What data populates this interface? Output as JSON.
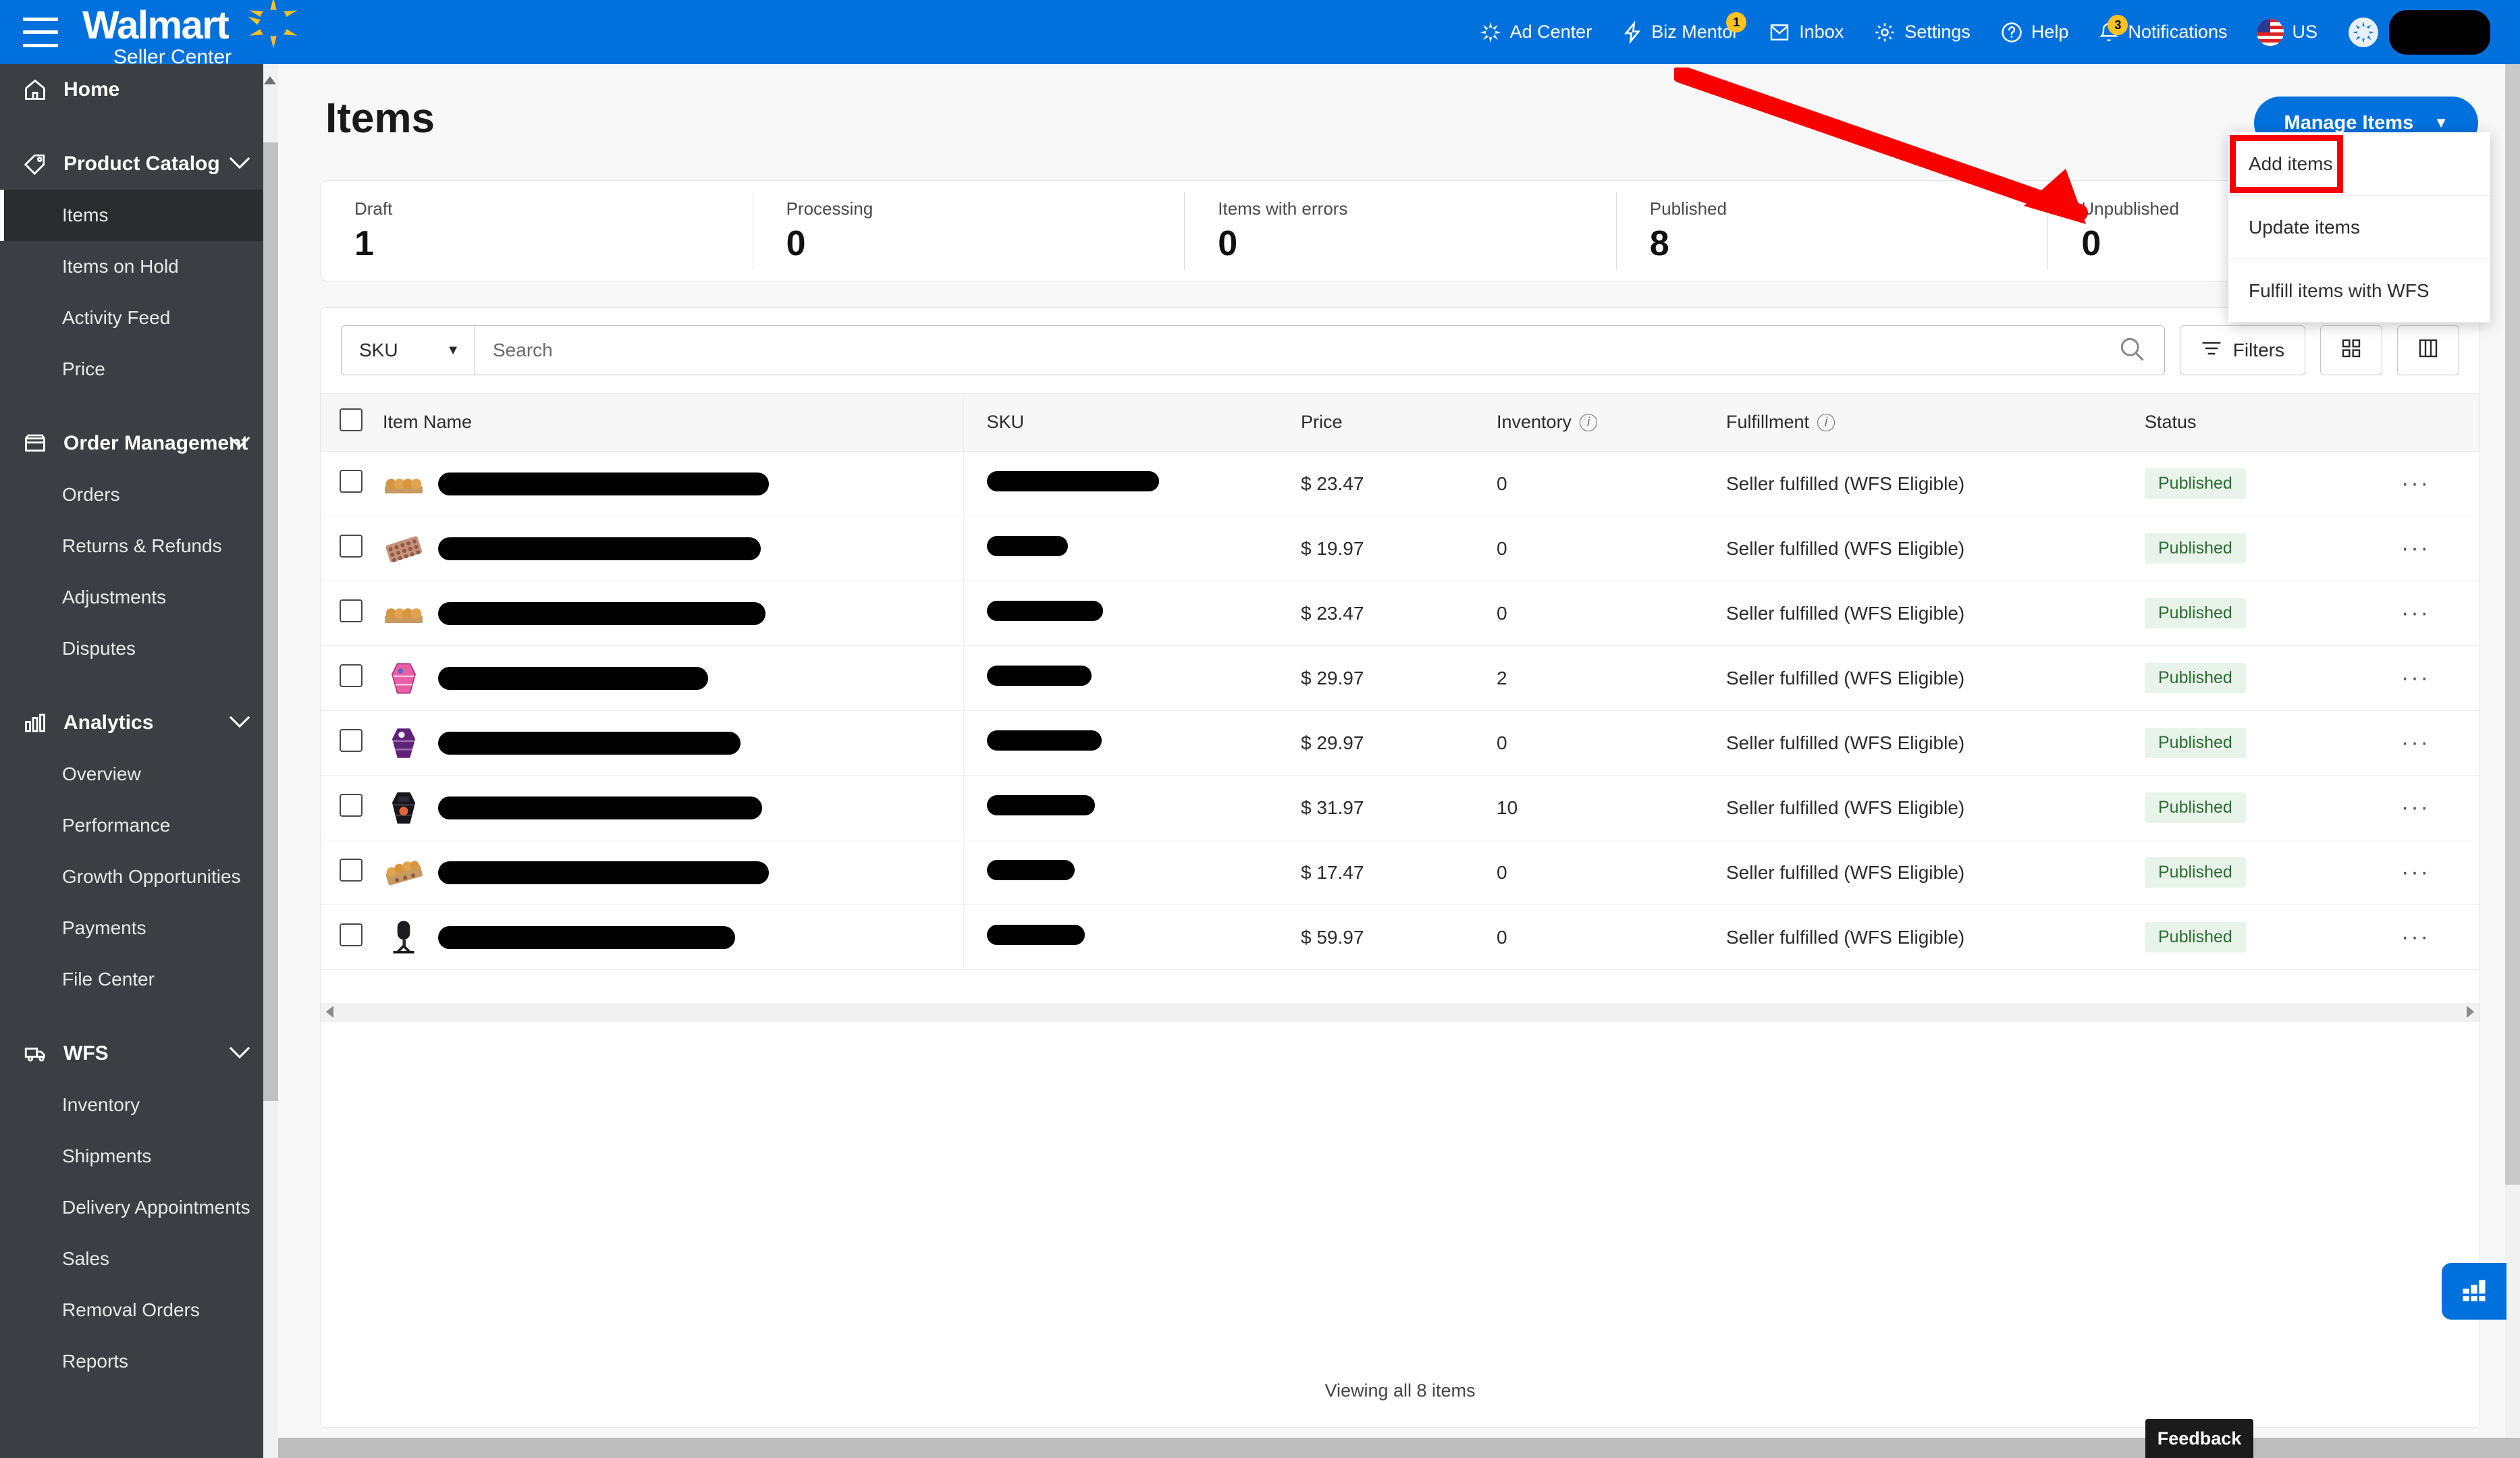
{
  "topbar": {
    "brand_word": "Walmart",
    "brand_sub": "Seller Center",
    "nav": [
      {
        "label": "Ad Center",
        "icon": "spark-icon",
        "badge": null
      },
      {
        "label": "Biz Mentor",
        "icon": "lightning-icon",
        "badge": "1"
      },
      {
        "label": "Inbox",
        "icon": "envelope-icon",
        "badge": null
      },
      {
        "label": "Settings",
        "icon": "gear-icon",
        "badge": null
      },
      {
        "label": "Help",
        "icon": "question-icon",
        "badge": null
      },
      {
        "label": "Notifications",
        "icon": "bell-icon",
        "badge": "3"
      },
      {
        "label": "US",
        "icon": "us-flag-icon",
        "badge": null
      }
    ]
  },
  "sidebar": {
    "groups": [
      {
        "label": "Home",
        "icon": "home-icon",
        "expandable": false,
        "items": []
      },
      {
        "label": "Product Catalog",
        "icon": "tag-icon",
        "expandable": true,
        "items": [
          {
            "label": "Items",
            "active": true
          },
          {
            "label": "Items on Hold",
            "active": false
          },
          {
            "label": "Activity Feed",
            "active": false
          },
          {
            "label": "Price",
            "active": false
          }
        ]
      },
      {
        "label": "Order Management",
        "icon": "box-icon",
        "expandable": true,
        "items": [
          {
            "label": "Orders",
            "active": false
          },
          {
            "label": "Returns & Refunds",
            "active": false
          },
          {
            "label": "Adjustments",
            "active": false
          },
          {
            "label": "Disputes",
            "active": false
          }
        ]
      },
      {
        "label": "Analytics",
        "icon": "bars-icon",
        "expandable": true,
        "items": [
          {
            "label": "Overview",
            "active": false
          },
          {
            "label": "Performance",
            "active": false
          },
          {
            "label": "Growth Opportunities",
            "active": false
          },
          {
            "label": "Payments",
            "active": false
          },
          {
            "label": "File Center",
            "active": false
          }
        ]
      },
      {
        "label": "WFS",
        "icon": "truck-icon",
        "expandable": true,
        "items": [
          {
            "label": "Inventory",
            "active": false
          },
          {
            "label": "Shipments",
            "active": false
          },
          {
            "label": "Delivery Appointments",
            "active": false
          },
          {
            "label": "Sales",
            "active": false
          },
          {
            "label": "Removal Orders",
            "active": false
          },
          {
            "label": "Reports",
            "active": false
          }
        ]
      }
    ]
  },
  "page": {
    "title": "Items",
    "manage_items_label": "Manage Items"
  },
  "dropdown": {
    "items": [
      {
        "label": "Add items",
        "highlighted": true
      },
      {
        "label": "Update items",
        "highlighted": false
      },
      {
        "label": "Fulfill items with WFS",
        "highlighted": false
      }
    ]
  },
  "stats": [
    {
      "label": "Draft",
      "value": "1"
    },
    {
      "label": "Processing",
      "value": "0"
    },
    {
      "label": "Items with errors",
      "value": "0"
    },
    {
      "label": "Published",
      "value": "8"
    },
    {
      "label": "Unpublished",
      "value": "0"
    }
  ],
  "toolbar": {
    "search_field_selected": "SKU",
    "search_placeholder": "Search",
    "search_value": "",
    "filters_label": "Filters",
    "search_icon": "magnifier-icon",
    "filters_icon": "filter-lines-icon",
    "grid_view_icon": "grid-view-icon",
    "extra_button_icon": "column-settings-icon"
  },
  "table": {
    "columns": [
      {
        "label": "",
        "name": "select-all"
      },
      {
        "label": "Item Name",
        "name": "item-name",
        "info": false
      },
      {
        "label": "SKU",
        "name": "sku",
        "info": false
      },
      {
        "label": "Price",
        "name": "price",
        "info": false
      },
      {
        "label": "Inventory",
        "name": "inventory",
        "info": true
      },
      {
        "label": "Fulfillment",
        "name": "fulfillment",
        "info": true
      },
      {
        "label": "Status",
        "name": "status",
        "info": false
      }
    ],
    "rows": [
      {
        "thumb": "muffin-tray-thumb",
        "name_redacted": true,
        "name_width": 490,
        "sku_redacted": true,
        "sku_width": 255,
        "price": "$ 23.47",
        "inventory": "0",
        "fulfillment": "Seller fulfilled (WFS Eligible)",
        "status": "Published"
      },
      {
        "thumb": "chocolate-mold-thumb",
        "name_redacted": true,
        "name_width": 478,
        "sku_redacted": true,
        "sku_width": 120,
        "price": "$ 19.97",
        "inventory": "0",
        "fulfillment": "Seller fulfilled (WFS Eligible)",
        "status": "Published"
      },
      {
        "thumb": "muffin-tray-thumb",
        "name_redacted": true,
        "name_width": 485,
        "sku_redacted": true,
        "sku_width": 172,
        "price": "$ 23.47",
        "inventory": "0",
        "fulfillment": "Seller fulfilled (WFS Eligible)",
        "status": "Published"
      },
      {
        "thumb": "pink-coffin-shelf-thumb",
        "name_redacted": true,
        "name_width": 400,
        "sku_redacted": true,
        "sku_width": 155,
        "price": "$ 29.97",
        "inventory": "2",
        "fulfillment": "Seller fulfilled (WFS Eligible)",
        "status": "Published"
      },
      {
        "thumb": "purple-coffin-shelf-thumb",
        "name_redacted": true,
        "name_width": 448,
        "sku_redacted": true,
        "sku_width": 170,
        "price": "$ 29.97",
        "inventory": "0",
        "fulfillment": "Seller fulfilled (WFS Eligible)",
        "status": "Published"
      },
      {
        "thumb": "black-coffin-shelf-thumb",
        "name_redacted": true,
        "name_width": 480,
        "sku_redacted": true,
        "sku_width": 160,
        "price": "$ 31.97",
        "inventory": "10",
        "fulfillment": "Seller fulfilled (WFS Eligible)",
        "status": "Published"
      },
      {
        "thumb": "donut-tray-thumb",
        "name_redacted": true,
        "name_width": 490,
        "sku_redacted": true,
        "sku_width": 130,
        "price": "$ 17.47",
        "inventory": "0",
        "fulfillment": "Seller fulfilled (WFS Eligible)",
        "status": "Published"
      },
      {
        "thumb": "microphone-thumb",
        "name_redacted": true,
        "name_width": 440,
        "sku_redacted": true,
        "sku_width": 145,
        "price": "$ 59.97",
        "inventory": "0",
        "fulfillment": "Seller fulfilled (WFS Eligible)",
        "status": "Published"
      }
    ],
    "row_more_icon": "ellipsis-icon"
  },
  "footer": {
    "viewing_text": "Viewing all 8 items",
    "feedback_label": "Feedback",
    "fab_icon": "analytics-bars-icon"
  },
  "colors": {
    "brand_blue": "#0071dc",
    "brand_yellow": "#ffc220",
    "sidebar_bg": "#3b3e42",
    "status_chip_bg": "#e8f4e9",
    "status_chip_text": "#2c6b33",
    "annotation_red": "#f90000"
  }
}
